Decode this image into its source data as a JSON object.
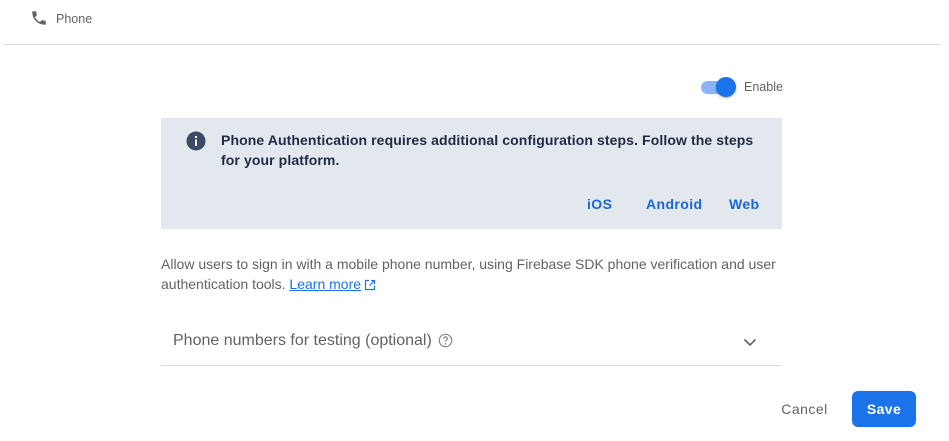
{
  "header": {
    "icon": "phone-icon",
    "title": "Phone"
  },
  "toggle": {
    "label": "Enable",
    "enabled": true
  },
  "info": {
    "icon": "info-icon",
    "text": "Phone Authentication requires additional configuration steps. Follow the steps for your platform.",
    "links": {
      "ios": "iOS",
      "android": "Android",
      "web": "Web"
    }
  },
  "description": {
    "text": "Allow users to sign in with a mobile phone number, using Firebase SDK phone verification and user authentication tools.",
    "learn_more": "Learn more",
    "learn_more_icon": "external-link-icon"
  },
  "testing": {
    "label": "Phone numbers for testing (optional)",
    "help_icon": "help-circle-icon",
    "expand_icon": "chevron-down-icon"
  },
  "actions": {
    "cancel": "Cancel",
    "save": "Save"
  },
  "colors": {
    "accent": "#1a73e8",
    "info_background": "#e3e8ee",
    "toggle_track": "#8ab4f8"
  }
}
